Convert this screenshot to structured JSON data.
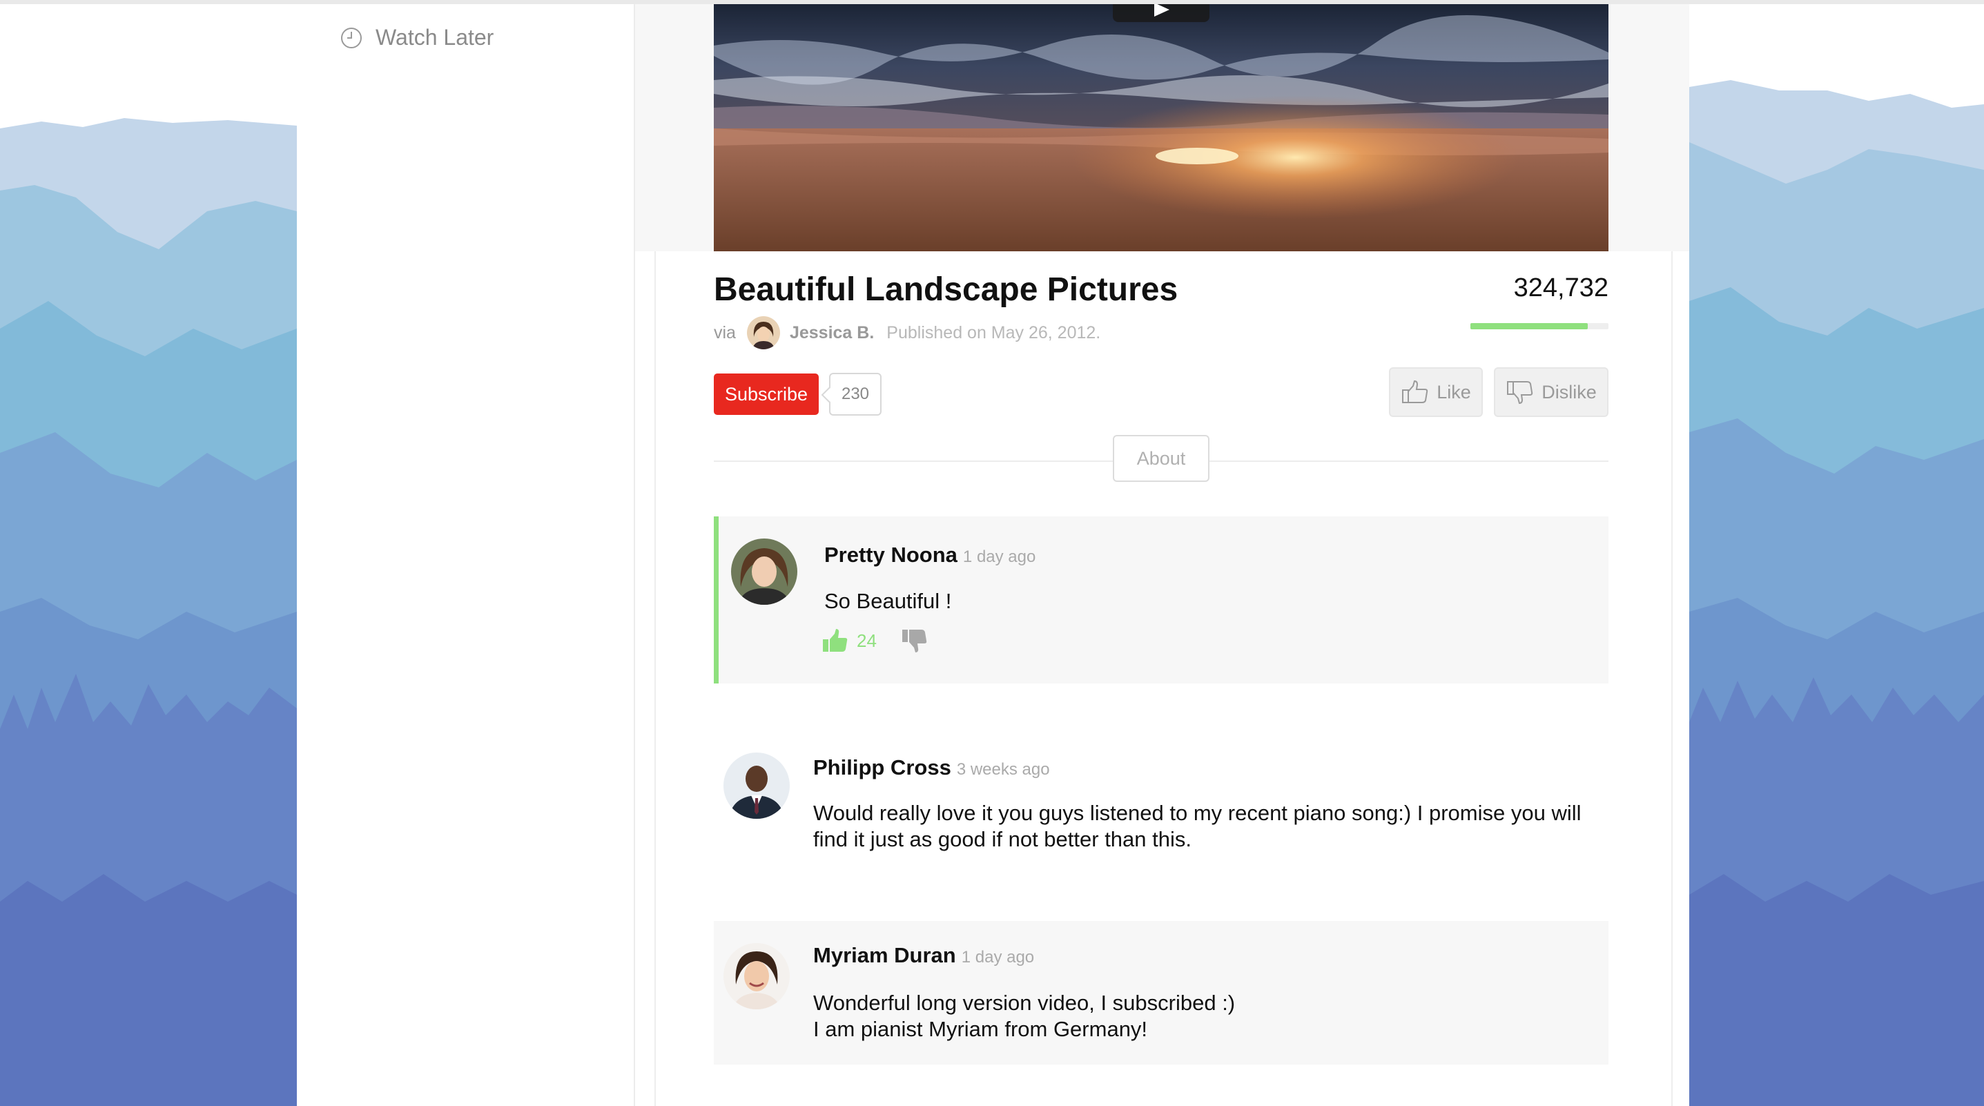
{
  "sidebar": {
    "watch_later_label": "Watch Later",
    "watch_later_icon": "clock-icon"
  },
  "video": {
    "title": "Beautiful Landscape Pictures",
    "via_label": "via",
    "author": "Jessica B.",
    "published": "Published on May 26, 2012.",
    "views": "324,732",
    "rating_fraction": 0.85,
    "rating_color": "#8fe07e",
    "play_icon": "play-icon"
  },
  "actions": {
    "subscribe_label": "Subscribe",
    "subscriber_count": "230",
    "subscribe_color": "#e8281f",
    "like_label": "Like",
    "dislike_label": "Dislike",
    "about_label": "About"
  },
  "comments": [
    {
      "name": "Pretty Noona",
      "time": "1 day ago",
      "text": "So Beautiful !",
      "likes": "24",
      "highlight_color": "#8fe07e"
    },
    {
      "name": "Philipp Cross",
      "time": "3 weeks ago",
      "text": "Would really love it you guys listened to my recent piano song:) I promise you will\nfind it just as good if not better than this."
    },
    {
      "name": "Myriam Duran",
      "time": "1 day ago",
      "text": "Wonderful long version video, I subscribed :)\nI am pianist Myriam from Germany!"
    }
  ]
}
